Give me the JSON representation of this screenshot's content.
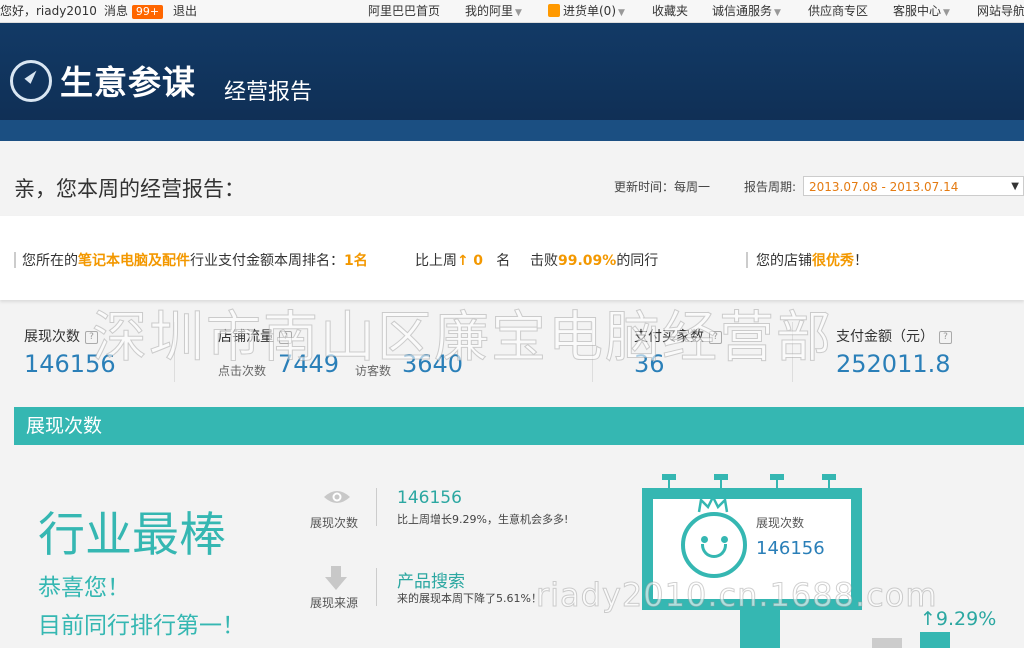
{
  "topbar": {
    "greeting": "您好，riady2010",
    "msg_label": "消息",
    "msg_count": "99+",
    "logout": "退出",
    "nav": [
      "阿里巴巴首页",
      "我的阿里",
      "进货单(0)",
      "收藏夹",
      "诚信通服务",
      "供应商专区",
      "客服中心",
      "网站导航"
    ]
  },
  "header": {
    "brand": "生意参谋",
    "sub": "经营报告"
  },
  "report": {
    "title": "亲，您本周的经营报告：",
    "update_time": "更新时间：每周一",
    "period_label": "报告周期:",
    "period_value": "2013.07.08 - 2013.07.14"
  },
  "rank": {
    "p1": "您所在的",
    "industry": "笔记本电脑及配件",
    "p2": "行业支付金额本周排名：",
    "rank": "1名",
    "p3": "比上周",
    "change": "0",
    "p4": "名",
    "p5": "击败",
    "beat": "99.09%",
    "p6": "的同行",
    "p7": "您的店铺",
    "level": "很优秀",
    "p8": "！"
  },
  "stats": {
    "impressions_label": "展现次数",
    "impressions": "146156",
    "traffic_label": "店铺流量",
    "clicks_label": "点击次数",
    "clicks": "7449",
    "visitors_label": "访客数",
    "visitors": "3640",
    "buyers_label": "支付买家数",
    "buyers": "36",
    "amount_label": "支付金额（元）",
    "amount": "252011.8",
    "help": "?"
  },
  "watermark": {
    "main": "深圳市南山区廉宝电脑经营部",
    "site": "riady2010.cn.1688.com"
  },
  "section": {
    "title": "展现次数",
    "big_title": "行业最棒",
    "congrats": "恭喜您！",
    "first": "目前同行排行第一！",
    "row1_label": "展现次数",
    "row1_value": "146156",
    "row1_desc": "比上周增长9.29%，生意机会多多!",
    "row2_label": "展现来源",
    "row2_value": "产品搜索",
    "row2_desc": "来的展现本周下降了5.61%！",
    "bb_label": "展现次数",
    "bb_value": "146156",
    "growth": "9.29%"
  },
  "colors": {
    "teal": "#35b7b2",
    "navy": "#123a66",
    "orange": "#f39800",
    "blue_value": "#2a7fb8"
  }
}
